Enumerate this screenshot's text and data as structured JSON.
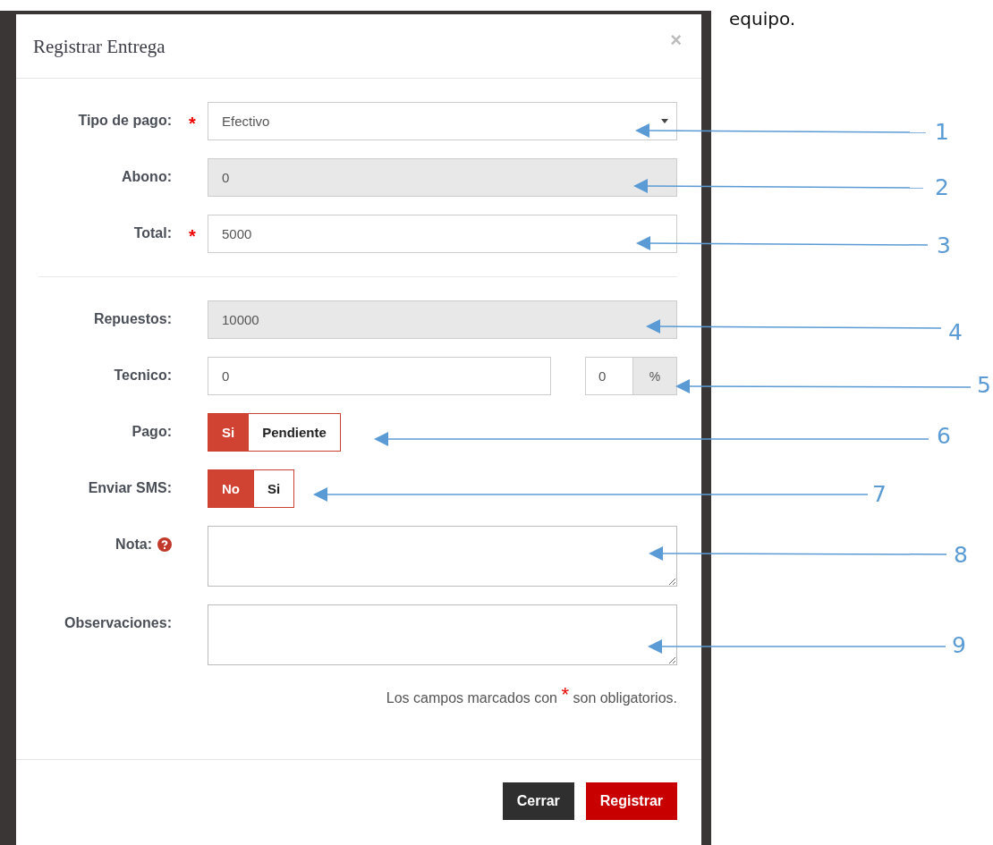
{
  "note_text": "equipo.",
  "modal": {
    "title": "Registrar Entrega",
    "close": "×",
    "sections": [
      {
        "fields": [
          {
            "kind": "select",
            "label": "Tipo de pago:",
            "required": true,
            "value": "Efectivo",
            "disabled": false
          },
          {
            "kind": "text",
            "label": "Abono:",
            "required": false,
            "value": "0",
            "disabled": true
          },
          {
            "kind": "text",
            "label": "Total:",
            "required": true,
            "value": "5000",
            "disabled": false
          }
        ]
      },
      {
        "fields": [
          {
            "kind": "text",
            "label": "Repuestos:",
            "required": false,
            "value": "10000",
            "disabled": true
          },
          {
            "kind": "percent",
            "label": "Tecnico:",
            "required": false,
            "value": "0",
            "percent_value": "0",
            "addon": "%",
            "disabled": false
          },
          {
            "kind": "toggle",
            "label": "Pago:",
            "required": false,
            "options": [
              {
                "label": "Si",
                "selected": true
              },
              {
                "label": "Pendiente",
                "selected": false
              }
            ]
          },
          {
            "kind": "toggle",
            "label": "Enviar SMS:",
            "required": false,
            "options": [
              {
                "label": "No",
                "selected": true
              },
              {
                "label": "Si",
                "selected": false
              }
            ]
          },
          {
            "kind": "textarea",
            "label": "Nota:",
            "required": false,
            "help": true
          },
          {
            "kind": "textarea",
            "label": "Observaciones:",
            "required": false,
            "help": false
          }
        ]
      }
    ],
    "required_note": {
      "before": "Los campos marcados con",
      "mark": "*",
      "after": "son obligatorios."
    },
    "buttons": [
      {
        "label": "Cerrar",
        "kind": "secondary"
      },
      {
        "label": "Registrar",
        "kind": "primary"
      }
    ]
  },
  "callouts": [
    {
      "number": "1"
    },
    {
      "number": "2"
    },
    {
      "number": "3"
    },
    {
      "number": "4"
    },
    {
      "number": "5"
    },
    {
      "number": "6"
    },
    {
      "number": "7"
    },
    {
      "number": "8"
    },
    {
      "number": "9"
    }
  ]
}
